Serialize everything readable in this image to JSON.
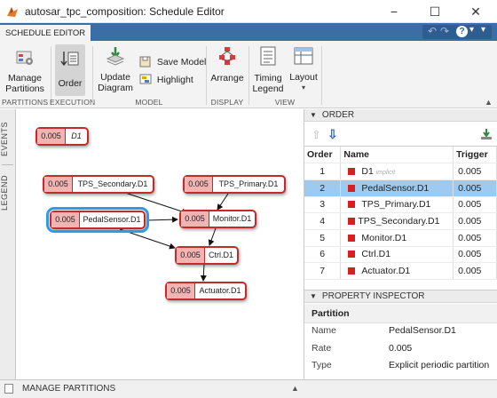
{
  "window": {
    "title": "autosar_tpc_composition: Schedule Editor",
    "minimize": "−",
    "maximize": "☐",
    "close": "✕"
  },
  "tab": {
    "label": "SCHEDULE EDITOR"
  },
  "quick_access": {
    "undo": "↶",
    "redo": "↷",
    "help": "?",
    "help_menu": "▾",
    "collapse": "▾"
  },
  "toolstrip": {
    "manage_partitions": "Manage Partitions",
    "order": "Order",
    "update_diagram": "Update Diagram",
    "save_model": "Save Model",
    "highlight": "Highlight",
    "arrange": "Arrange",
    "timing_legend": "Timing Legend",
    "layout": "Layout",
    "sections": {
      "partitions": "PARTITIONS",
      "execution": "EXECUTION",
      "model": "MODEL",
      "display": "DISPLAY",
      "view": "VIEW"
    }
  },
  "sidebar": {
    "events": "EVENTS",
    "legend": "LEGEND"
  },
  "canvas": {
    "blocks": [
      {
        "rate": "0.005",
        "name": "D1"
      },
      {
        "rate": "0.005",
        "name": "TPS_Secondary.D1"
      },
      {
        "rate": "0.005",
        "name": "TPS_Primary.D1"
      },
      {
        "rate": "0.005",
        "name": "PedalSensor.D1"
      },
      {
        "rate": "0.005",
        "name": "Monitor.D1"
      },
      {
        "rate": "0.005",
        "name": "Ctrl.D1"
      },
      {
        "rate": "0.005",
        "name": "Actuator.D1"
      }
    ]
  },
  "order_panel": {
    "title": "ORDER",
    "columns": {
      "order": "Order",
      "name": "Name",
      "trigger": "Trigger"
    },
    "rows": [
      {
        "order": "1",
        "name": "D1",
        "tag": "implicit",
        "trigger": "0.005"
      },
      {
        "order": "2",
        "name": "PedalSensor.D1",
        "tag": "",
        "trigger": "0.005"
      },
      {
        "order": "3",
        "name": "TPS_Primary.D1",
        "tag": "",
        "trigger": "0.005"
      },
      {
        "order": "4",
        "name": "TPS_Secondary.D1",
        "tag": "",
        "trigger": "0.005"
      },
      {
        "order": "5",
        "name": "Monitor.D1",
        "tag": "",
        "trigger": "0.005"
      },
      {
        "order": "6",
        "name": "Ctrl.D1",
        "tag": "",
        "trigger": "0.005"
      },
      {
        "order": "7",
        "name": "Actuator.D1",
        "tag": "",
        "trigger": "0.005"
      }
    ]
  },
  "inspector": {
    "title": "PROPERTY INSPECTOR",
    "section": "Partition",
    "props": [
      {
        "key": "Name",
        "value": "PedalSensor.D1"
      },
      {
        "key": "Rate",
        "value": "0.005"
      },
      {
        "key": "Type",
        "value": "Explicit periodic partition"
      }
    ]
  },
  "bottom": {
    "label": "MANAGE PARTITIONS"
  }
}
